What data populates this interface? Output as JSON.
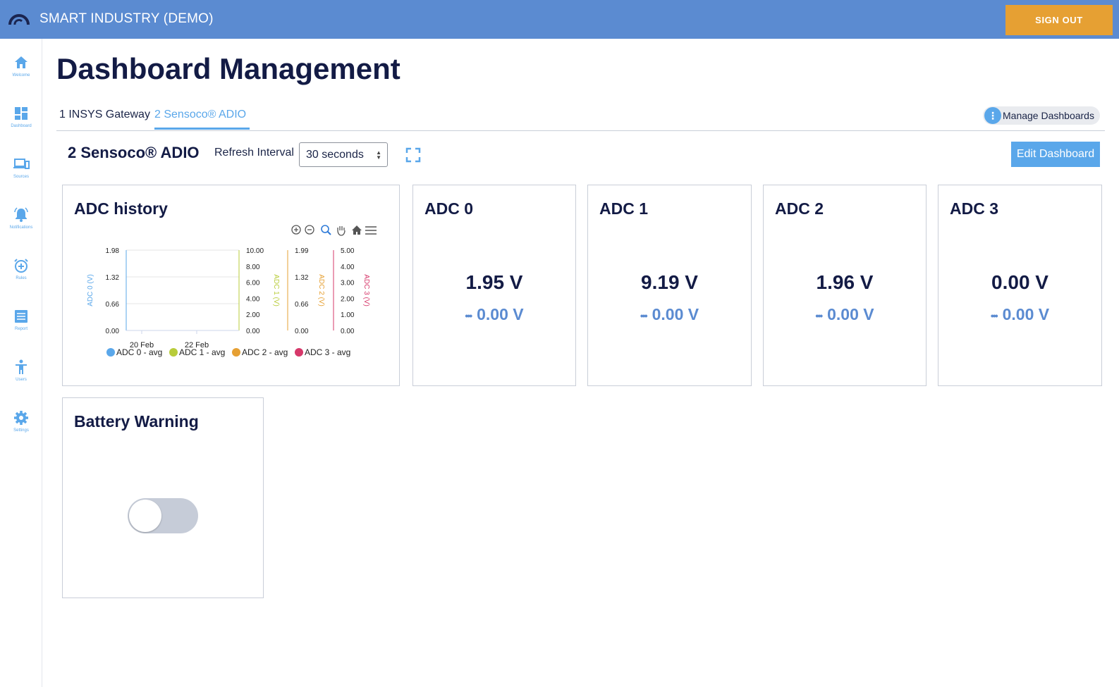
{
  "header": {
    "app_title": "SMART INDUSTRY (DEMO)",
    "sign_out_label": "SIGN OUT"
  },
  "sidebar": {
    "items": [
      {
        "label": "Welcome",
        "icon": "home-icon"
      },
      {
        "label": "Dashboard",
        "icon": "dashboard-icon"
      },
      {
        "label": "Sources",
        "icon": "devices-icon"
      },
      {
        "label": "Notifications",
        "icon": "bell-icon"
      },
      {
        "label": "Rules",
        "icon": "alarm-add-icon"
      },
      {
        "label": "Report",
        "icon": "report-icon"
      },
      {
        "label": "Users",
        "icon": "user-icon"
      },
      {
        "label": "Settings",
        "icon": "gear-icon"
      }
    ]
  },
  "page": {
    "title": "Dashboard Management",
    "tabs": [
      {
        "label": "1 INSYS Gateway",
        "active": false
      },
      {
        "label": "2 Sensoco® ADIO",
        "active": true
      }
    ],
    "manage_label": "Manage Dashboards"
  },
  "dashboard": {
    "title": "2 Sensoco® ADIO",
    "refresh_label": "Refresh Interval",
    "refresh_value": "30 seconds",
    "edit_label": "Edit Dashboard"
  },
  "widgets": {
    "history_title": "ADC history",
    "adc": [
      {
        "title": "ADC 0",
        "value": "1.95 V",
        "sub": "0.00 V"
      },
      {
        "title": "ADC 1",
        "value": "9.19 V",
        "sub": "0.00 V"
      },
      {
        "title": "ADC 2",
        "value": "1.96 V",
        "sub": "0.00 V"
      },
      {
        "title": "ADC 3",
        "value": "0.00 V",
        "sub": "0.00 V"
      }
    ],
    "battery_title": "Battery Warning",
    "battery_toggle_on": false
  },
  "chart_data": {
    "type": "line",
    "x_ticks": [
      "20 Feb",
      "22 Feb"
    ],
    "series": [
      {
        "name": "ADC 0 - avg",
        "color": "#5aa7ea",
        "axis_label": "ADC 0 (V)",
        "ticks": [
          "1.98",
          "1.32",
          "0.66",
          "0.00"
        ],
        "ylim": [
          0,
          1.98
        ],
        "values": []
      },
      {
        "name": "ADC 1 - avg",
        "color": "#b8cc3a",
        "axis_label": "ADC 1 (V)",
        "ticks": [
          "10.00",
          "8.00",
          "6.00",
          "4.00",
          "2.00",
          "0.00"
        ],
        "ylim": [
          0,
          10
        ],
        "values": []
      },
      {
        "name": "ADC 2 - avg",
        "color": "#e6a033",
        "axis_label": "ADC 2 (V)",
        "ticks": [
          "1.99",
          "1.32",
          "0.66",
          "0.00"
        ],
        "ylim": [
          0,
          1.99
        ],
        "values": []
      },
      {
        "name": "ADC 3 - avg",
        "color": "#d6386a",
        "axis_label": "ADC 3 (V)",
        "ticks": [
          "5.00",
          "4.00",
          "3.00",
          "2.00",
          "1.00",
          "0.00"
        ],
        "ylim": [
          0,
          5
        ],
        "values": []
      }
    ],
    "legend": "bottom",
    "toolbar_icons": [
      "zoom-in-icon",
      "zoom-out-icon",
      "zoom-select-icon",
      "pan-hand-icon",
      "reset-home-icon",
      "menu-icon"
    ]
  },
  "colors": {
    "header": "#5b8bd1",
    "accent": "#5aa7ea",
    "sign_out": "#e6a033"
  }
}
